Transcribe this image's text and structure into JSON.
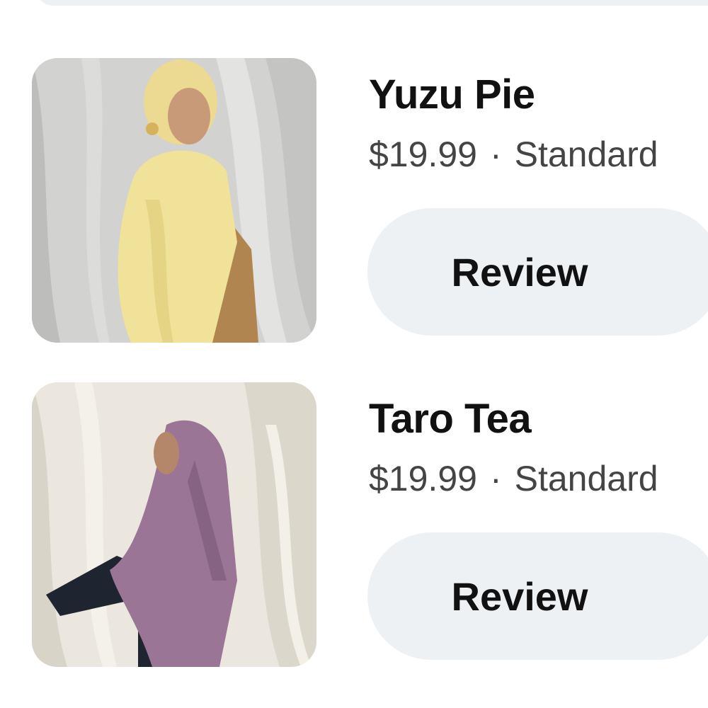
{
  "products": [
    {
      "name": "Yuzu Pie",
      "price": "$19.99",
      "separator": "·",
      "variant": "Standard",
      "action_label": "Review",
      "image_colors": {
        "backdrop": "#d4d4d2",
        "scarf": "#f2e39a",
        "jacket": "#b08550",
        "skin": "#c99a78"
      }
    },
    {
      "name": "Taro Tea",
      "price": "$19.99",
      "separator": "·",
      "variant": "Standard",
      "action_label": "Review",
      "image_colors": {
        "backdrop": "#ece8df",
        "scarf": "#9a7596",
        "sleeve": "#1f2530",
        "skin": "#b5876a"
      }
    }
  ]
}
